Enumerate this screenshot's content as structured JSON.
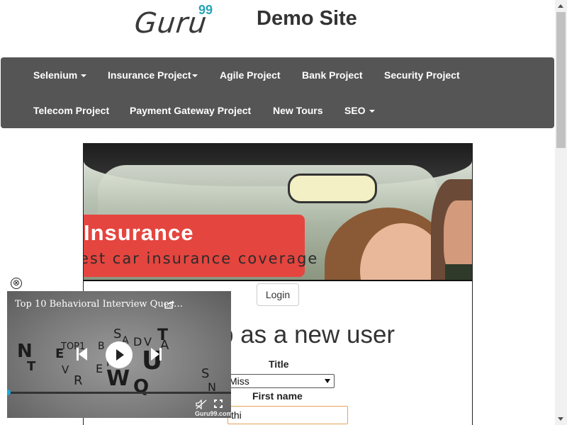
{
  "header": {
    "logo_text": "Guru",
    "logo_sup": "99",
    "site_title": "Demo Site"
  },
  "nav": {
    "items": [
      {
        "label": "Selenium",
        "dropdown": true
      },
      {
        "label": "Insurance Project",
        "dropdown": true
      },
      {
        "label": "Agile Project",
        "dropdown": false
      },
      {
        "label": "Bank Project",
        "dropdown": false
      },
      {
        "label": "Security Project",
        "dropdown": false
      },
      {
        "label": "Telecom Project",
        "dropdown": false
      },
      {
        "label": "Payment Gateway Project",
        "dropdown": false
      },
      {
        "label": "New Tours",
        "dropdown": false
      },
      {
        "label": "SEO",
        "dropdown": true
      }
    ]
  },
  "banner": {
    "title": "Insurance",
    "subtitle": "est car insurance coverage"
  },
  "form": {
    "login_button": "Login",
    "signup_title": "p as a new user",
    "title_label": "Title",
    "title_value": "Miss",
    "first_name_label": "First name",
    "first_name_value": "thi"
  },
  "video": {
    "title": "Top 10 Behavioral Interview Ques…",
    "close_symbol": "⊗",
    "brand": "Guru99.com",
    "words": [
      "N",
      "T",
      "TOP1",
      "E",
      "V",
      "R",
      "S",
      "A",
      "D",
      "V",
      "B",
      "U",
      "I",
      "W",
      "Q",
      "T",
      "A",
      "E",
      "S",
      "N"
    ]
  },
  "colors": {
    "navbar_bg": "#555555",
    "banner_red": "#e5453f",
    "logo_accent": "#2aa3b8",
    "progress_accent": "#19a9e5"
  }
}
